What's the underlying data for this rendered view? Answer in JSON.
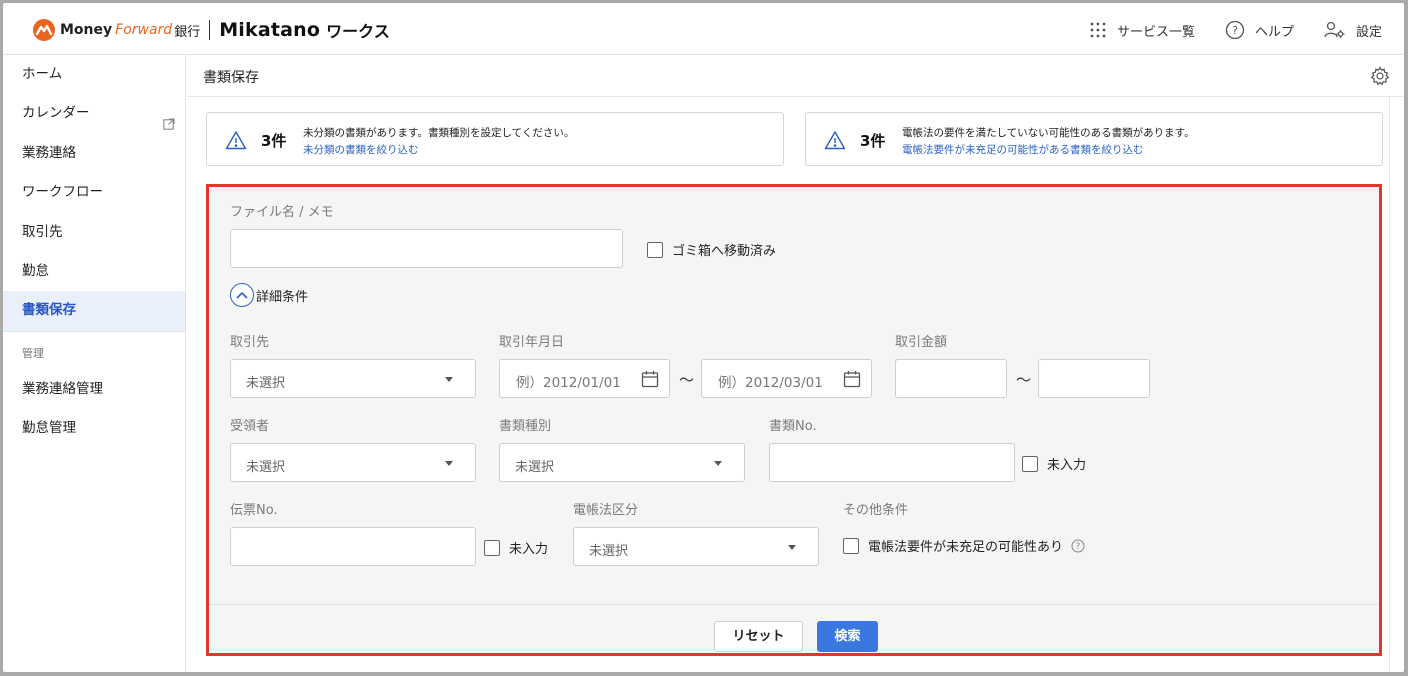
{
  "header": {
    "logo_money": "Money",
    "logo_forward": "Forward",
    "logo_bank": "銀行",
    "logo_mikatano": "Mikatano",
    "logo_works": "ワークス",
    "nav": [
      {
        "label": "サービス一覧",
        "icon": "grid-icon"
      },
      {
        "label": "ヘルプ",
        "icon": "help-circle-icon"
      },
      {
        "label": "設定",
        "icon": "user-settings-icon"
      }
    ]
  },
  "sidebar": {
    "items": [
      {
        "label": "ホーム"
      },
      {
        "label": "カレンダー",
        "icon": "external-link-icon"
      },
      {
        "label": "業務連絡"
      },
      {
        "label": "ワークフロー"
      },
      {
        "label": "取引先"
      },
      {
        "label": "勤怠"
      },
      {
        "label": "書類保存",
        "active": true
      }
    ],
    "section_label": "管理",
    "admin_items": [
      {
        "label": "業務連絡管理"
      },
      {
        "label": "勤怠管理"
      }
    ]
  },
  "page": {
    "title": "書類保存"
  },
  "alerts": [
    {
      "count": "3件",
      "message": "未分類の書類があります。書類種別を設定してください。",
      "link": "未分類の書類を絞り込む"
    },
    {
      "count": "3件",
      "message": "電帳法の要件を満たしていない可能性のある書類があります。",
      "link": "電帳法要件が未充足の可能性がある書類を絞り込む"
    }
  ],
  "search": {
    "filename_label": "ファイル名 / メモ",
    "filename_value": "",
    "trash_label": "ゴミ箱へ移動済み",
    "detail_toggle": "詳細条件",
    "partner_label": "取引先",
    "partner_value": "未選択",
    "date_label": "取引年月日",
    "date_from_placeholder": "例）2012/01/01",
    "date_to_placeholder": "例）2012/03/01",
    "tilde": "〜",
    "amount_label": "取引金額",
    "receiver_label": "受領者",
    "receiver_value": "未選択",
    "doctype_label": "書類種別",
    "doctype_value": "未選択",
    "docno_label": "書類No.",
    "docno_empty_label": "未入力",
    "slipno_label": "伝票No.",
    "slipno_empty_label": "未入力",
    "ebook_label": "電帳法区分",
    "ebook_value": "未選択",
    "other_label": "その他条件",
    "other_check_label": "電帳法要件が未充足の可能性あり",
    "reset_label": "リセット",
    "search_label": "検索"
  },
  "colors": {
    "accent": "#3a78e0",
    "brand_orange": "#e9651e",
    "highlight_border": "#e0362b",
    "active_nav_bg": "#e9f0fb"
  }
}
